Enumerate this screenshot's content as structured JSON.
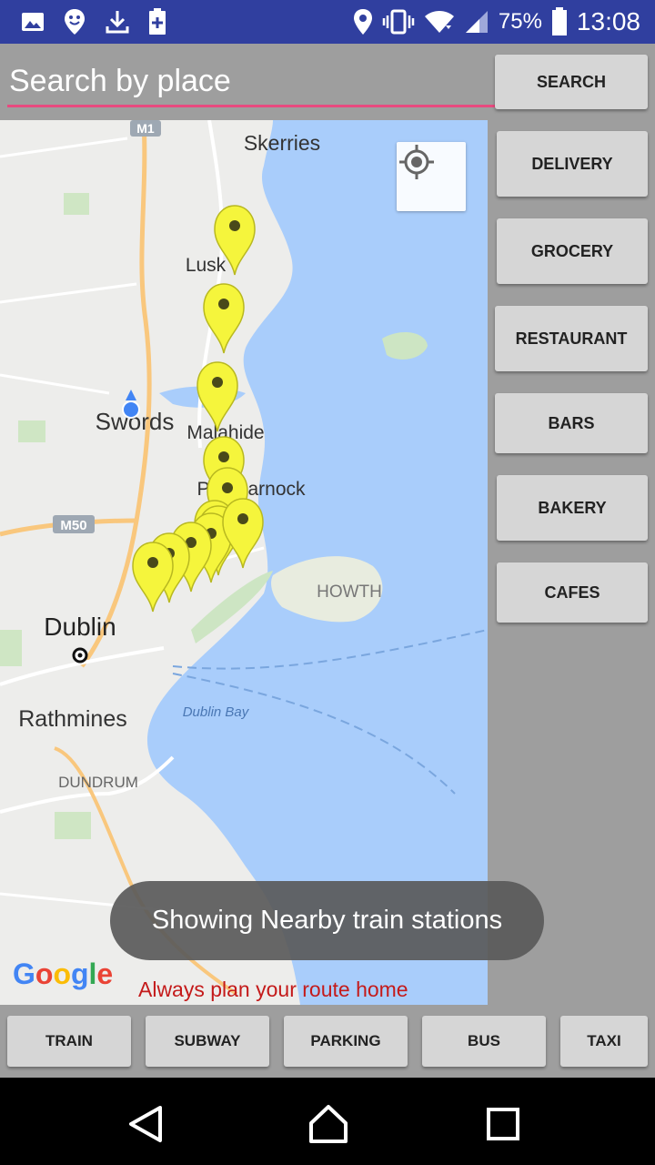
{
  "status_bar": {
    "battery_percent": "75%",
    "time": "13:08",
    "icons_left": [
      "image-icon",
      "smiley-icon",
      "download-icon",
      "battery-plus-icon"
    ],
    "icons_right": [
      "location-icon",
      "vibrate-icon",
      "wifi-icon",
      "signal-icon",
      "battery-icon"
    ],
    "bg_color": "#303f9f"
  },
  "search": {
    "placeholder": "Search by place",
    "value": "",
    "button_label": "SEARCH",
    "underline_color": "#e84a7f"
  },
  "categories": [
    "DELIVERY",
    "GROCERY",
    "RESTAURANT",
    "BARS",
    "BAKERY",
    "CAFES"
  ],
  "map": {
    "place_labels": [
      "Skerries",
      "Lusk",
      "Swords",
      "Malahide",
      "Portmarnock",
      "HOWTH",
      "Dublin",
      "Rathmines",
      "DUNDRUM",
      "Dublin Bay"
    ],
    "road_labels": [
      "M1",
      "M50"
    ],
    "marker_color": "#f5f53c",
    "marker_count": 11,
    "my_location_button": "my-location-icon",
    "attribution": "Google"
  },
  "toast": "Showing Nearby train stations",
  "route_note": "Always plan your route home",
  "transport": [
    "TRAIN",
    "SUBWAY",
    "PARKING",
    "BUS",
    "TAXI"
  ],
  "nav": [
    "back-icon",
    "home-icon",
    "recents-icon"
  ]
}
